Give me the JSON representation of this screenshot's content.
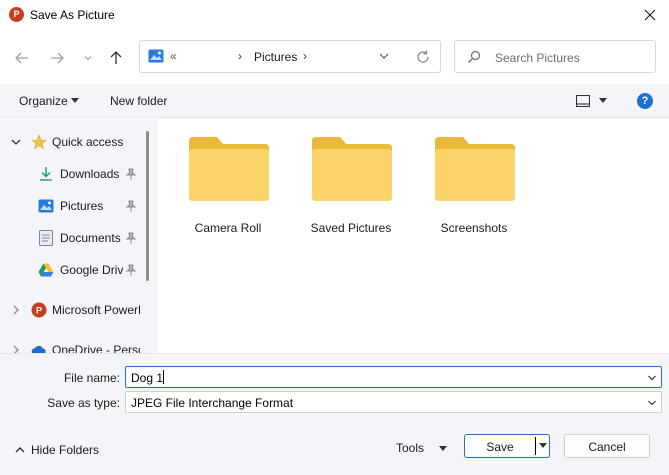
{
  "window": {
    "title": "Save As Picture",
    "app_icon_letter": "P"
  },
  "navigation": {
    "address": {
      "overflow": "«",
      "location": "Pictures"
    },
    "search": {
      "placeholder": "Search Pictures"
    }
  },
  "command_bar": {
    "organize_label": "Organize",
    "new_folder_label": "New folder",
    "help_label": "?"
  },
  "sidebar": {
    "items": [
      {
        "label": "Quick access",
        "icon": "star-icon",
        "expanded": true
      },
      {
        "label": "Downloads",
        "icon": "download-icon",
        "pinned": true
      },
      {
        "label": "Pictures",
        "icon": "pictures-icon",
        "pinned": true
      },
      {
        "label": "Documents",
        "icon": "documents-icon",
        "pinned": true
      },
      {
        "label": "Google Drive",
        "icon": "google-drive-icon",
        "pinned": true
      },
      {
        "label": "Microsoft PowerPoint",
        "icon": "powerpoint-icon",
        "expanded": false
      },
      {
        "label": "OneDrive - Personal",
        "icon": "onedrive-icon",
        "expanded": false
      }
    ]
  },
  "content": {
    "folders": [
      {
        "label": "Camera Roll",
        "icon": "folder-icon"
      },
      {
        "label": "Saved Pictures",
        "icon": "folder-icon"
      },
      {
        "label": "Screenshots",
        "icon": "folder-icon"
      }
    ]
  },
  "footer": {
    "file_name_label": "File name:",
    "file_name_value": "Dog 1",
    "save_as_type_label": "Save as type:",
    "save_as_type_value": "JPEG File Interchange Format",
    "hide_folders_label": "Hide Folders",
    "tools_label": "Tools",
    "save_label": "Save",
    "cancel_label": "Cancel"
  },
  "colors": {
    "accent": "#1f6fd0",
    "powerpoint": "#c43e1c",
    "folder": "#f8d775",
    "panel": "#f3f5f9"
  }
}
